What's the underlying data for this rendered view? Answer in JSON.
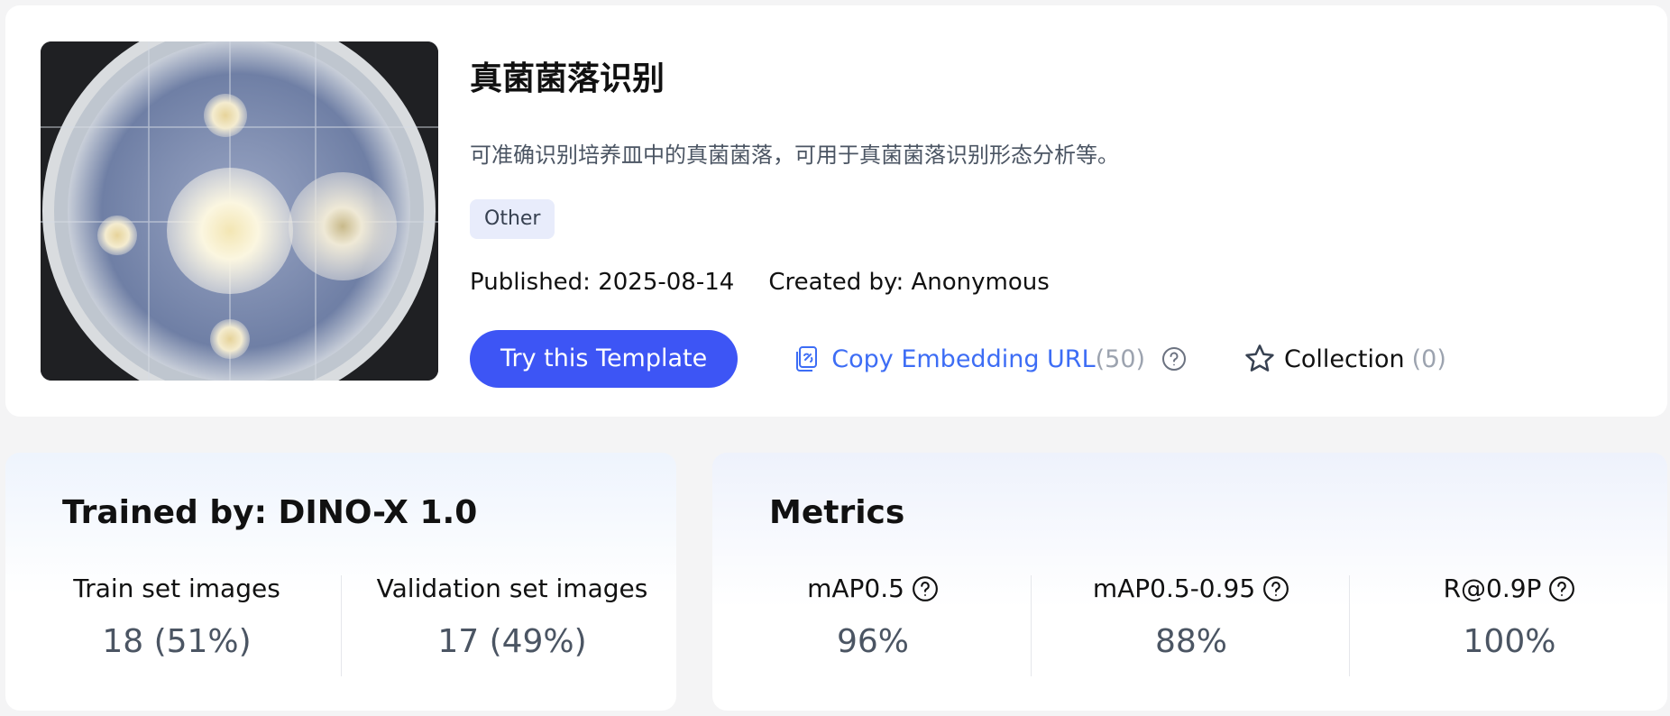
{
  "template": {
    "title": "真菌菌落识别",
    "description": "可准确识别培养皿中的真菌菌落，可用于真菌菌落识别形态分析等。",
    "tag": "Other",
    "published": "Published: 2025-08-14",
    "created_by": "Created by: Anonymous"
  },
  "actions": {
    "try_label": "Try this Template",
    "copy_label": "Copy Embedding URL",
    "copy_count": "(50)",
    "collection_label": "Collection",
    "collection_count": "(0)"
  },
  "trained": {
    "title": "Trained by: DINO-X 1.0",
    "train_label": "Train set images",
    "train_value": "18 (51%)",
    "val_label": "Validation set images",
    "val_value": "17 (49%)"
  },
  "metrics": {
    "title": "Metrics",
    "items": [
      {
        "label": "mAP0.5",
        "value": "96%"
      },
      {
        "label": "mAP0.5-0.95",
        "value": "88%"
      },
      {
        "label": "R@0.9P",
        "value": "100%"
      }
    ]
  },
  "colors": {
    "primary": "#3d55f5",
    "link": "#3d6df5",
    "muted": "#9ca3af",
    "tag_bg": "#e8ecfb"
  },
  "icons": {
    "copy": "copy-link-icon",
    "help": "question-circle-icon",
    "collection": "star-outline-icon"
  }
}
